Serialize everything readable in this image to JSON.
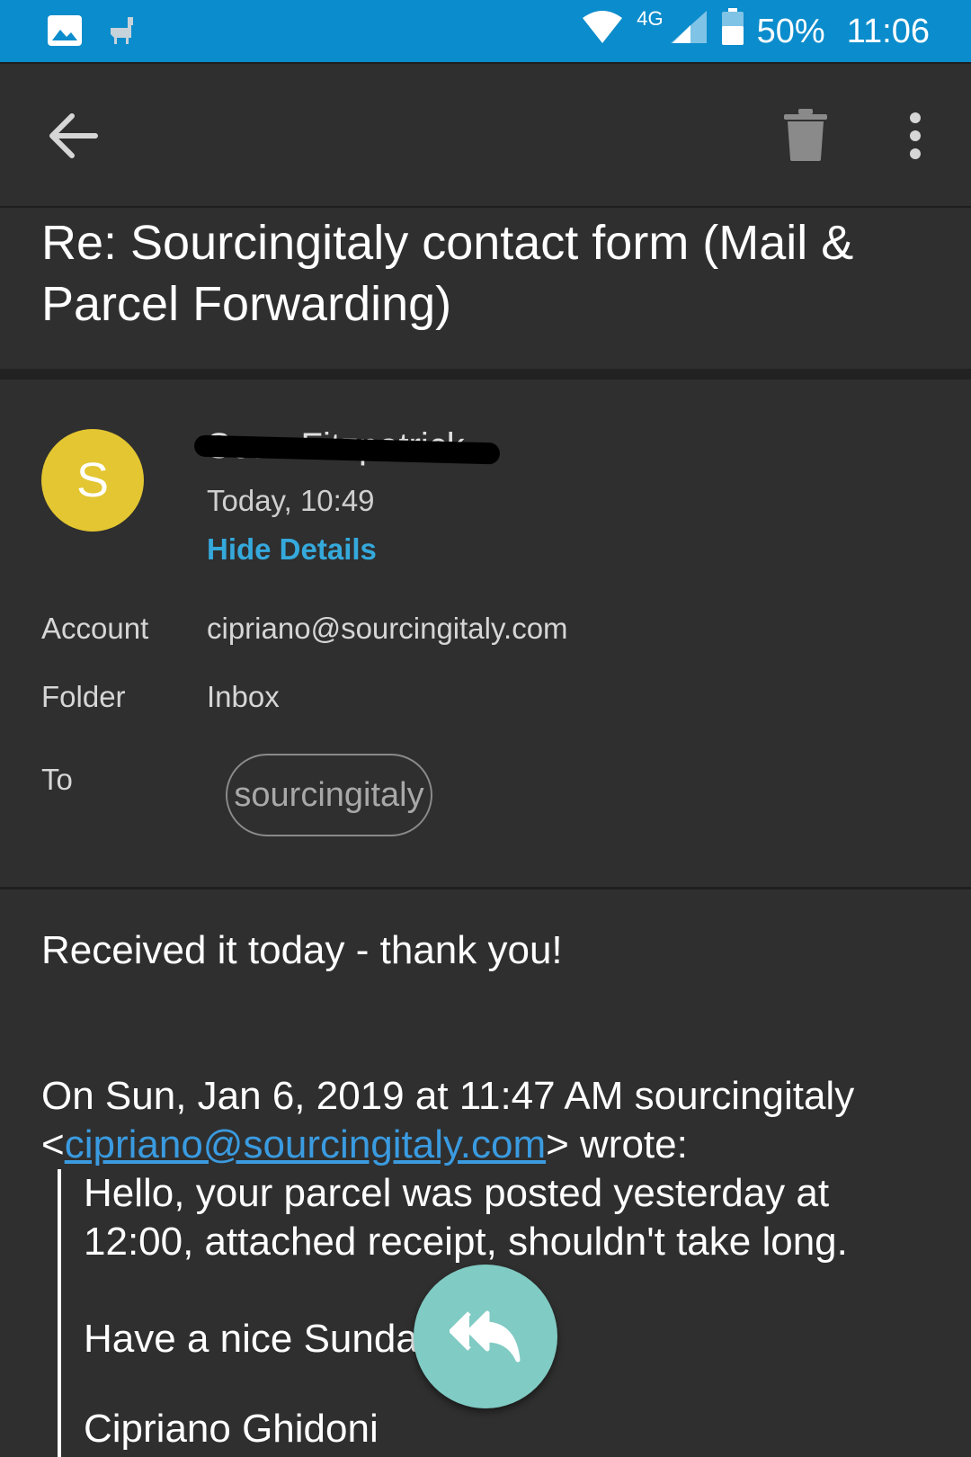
{
  "status_bar": {
    "network": "4G",
    "battery": "50%",
    "time": "11:06",
    "icons": [
      "image-icon",
      "llama-icon",
      "wifi-icon",
      "signal-icon",
      "battery-icon"
    ]
  },
  "toolbar": {
    "back_icon": "arrow-back-icon",
    "delete_icon": "trash-icon",
    "more_icon": "more-vert-icon"
  },
  "email": {
    "subject": "Re: Sourcingitaly contact form (Mail & Parcel Forwarding)",
    "avatar_letter": "S",
    "avatar_color": "#e3c631",
    "sender": "Sean Fitzpatrick",
    "date": "Today, 10:49",
    "hide_details": "Hide Details",
    "details": {
      "account_label": "Account",
      "account_value": "cipriano@sourcingitaly.com",
      "folder_label": "Folder",
      "folder_value": "Inbox",
      "to_label": "To",
      "to_value": "sourcingitaly"
    },
    "body": {
      "reply_line": "Received it today - thank you!",
      "quote_header_1": "On Sun, Jan 6, 2019 at 11:47 AM sourcingitaly",
      "quote_header_open": "<",
      "quote_header_email": "cipriano@sourcingitaly.com",
      "quote_header_close": "> wrote:",
      "quote_line_1": "Hello, your parcel was posted yesterday at",
      "quote_line_2": "12:00, attached receipt, shouldn't take long.",
      "quote_line_3": "Have a nice Sunday",
      "quote_line_4": "Cipriano Ghidoni"
    }
  },
  "fab": {
    "icon": "reply-all-icon"
  },
  "colors": {
    "status_bar": "#0b8ccc",
    "background": "#2f2f2f",
    "link": "#35a9dc",
    "fab": "#80cbc4"
  }
}
